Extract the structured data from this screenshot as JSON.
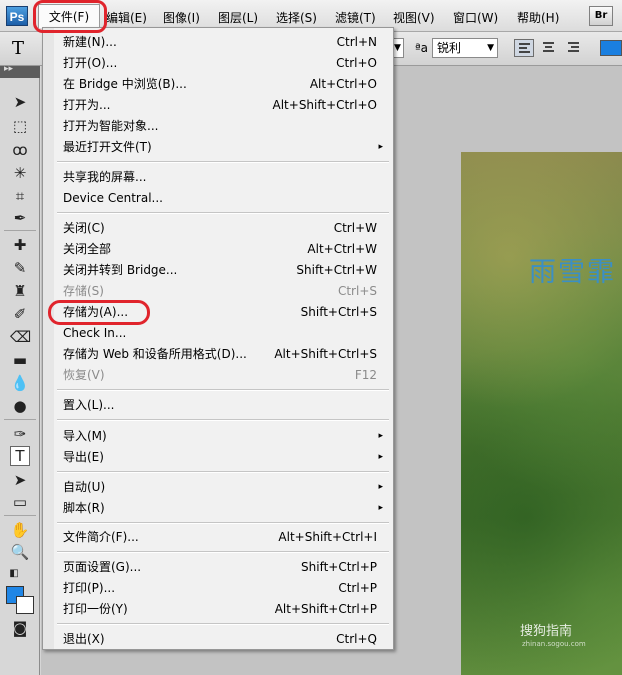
{
  "app": {
    "logo": "Ps",
    "bridge_button": "Br"
  },
  "menubar": {
    "items": [
      "文件(F)",
      "编辑(E)",
      "图像(I)",
      "图层(L)",
      "选择(S)",
      "滤镜(T)",
      "视图(V)",
      "窗口(W)",
      "帮助(H)"
    ]
  },
  "options": {
    "tool_glyph": "T",
    "aa_icon": "ªa",
    "antialias": "锐利"
  },
  "file_menu": {
    "items": [
      {
        "label": "新建(N)...",
        "shortcut": "Ctrl+N"
      },
      {
        "label": "打开(O)...",
        "shortcut": "Ctrl+O"
      },
      {
        "label": "在 Bridge 中浏览(B)...",
        "shortcut": "Alt+Ctrl+O"
      },
      {
        "label": "打开为...",
        "shortcut": "Alt+Shift+Ctrl+O"
      },
      {
        "label": "打开为智能对象...",
        "shortcut": ""
      },
      {
        "label": "最近打开文件(T)",
        "shortcut": "",
        "submenu": "▸"
      },
      {
        "label": "共享我的屏幕...",
        "shortcut": ""
      },
      {
        "label": "Device Central...",
        "shortcut": ""
      },
      {
        "label": "关闭(C)",
        "shortcut": "Ctrl+W"
      },
      {
        "label": "关闭全部",
        "shortcut": "Alt+Ctrl+W"
      },
      {
        "label": "关闭并转到 Bridge...",
        "shortcut": "Shift+Ctrl+W"
      },
      {
        "label": "存储(S)",
        "shortcut": "Ctrl+S",
        "disabled": true
      },
      {
        "label": "存储为(A)...",
        "shortcut": "Shift+Ctrl+S"
      },
      {
        "label": "Check In...",
        "shortcut": ""
      },
      {
        "label": "存储为 Web 和设备所用格式(D)...",
        "shortcut": "Alt+Shift+Ctrl+S"
      },
      {
        "label": "恢复(V)",
        "shortcut": "F12",
        "disabled": true
      },
      {
        "label": "置入(L)...",
        "shortcut": ""
      },
      {
        "label": "导入(M)",
        "shortcut": "",
        "submenu": "▸"
      },
      {
        "label": "导出(E)",
        "shortcut": "",
        "submenu": "▸"
      },
      {
        "label": "自动(U)",
        "shortcut": "",
        "submenu": "▸"
      },
      {
        "label": "脚本(R)",
        "shortcut": "",
        "submenu": "▸"
      },
      {
        "label": "文件简介(F)...",
        "shortcut": "Alt+Shift+Ctrl+I"
      },
      {
        "label": "页面设置(G)...",
        "shortcut": "Shift+Ctrl+P"
      },
      {
        "label": "打印(P)...",
        "shortcut": "Ctrl+P"
      },
      {
        "label": "打印一份(Y)",
        "shortcut": "Alt+Shift+Ctrl+P"
      },
      {
        "label": "退出(X)",
        "shortcut": "Ctrl+Q"
      }
    ]
  },
  "canvas": {
    "overlay_text": "雨雪霏",
    "watermark": "搜狗指南",
    "watermark_sub": "zhinan.sogou.com"
  },
  "colors": {
    "highlight": "#e0242c",
    "foreground": "#1f86e6",
    "background": "#ffffff"
  }
}
